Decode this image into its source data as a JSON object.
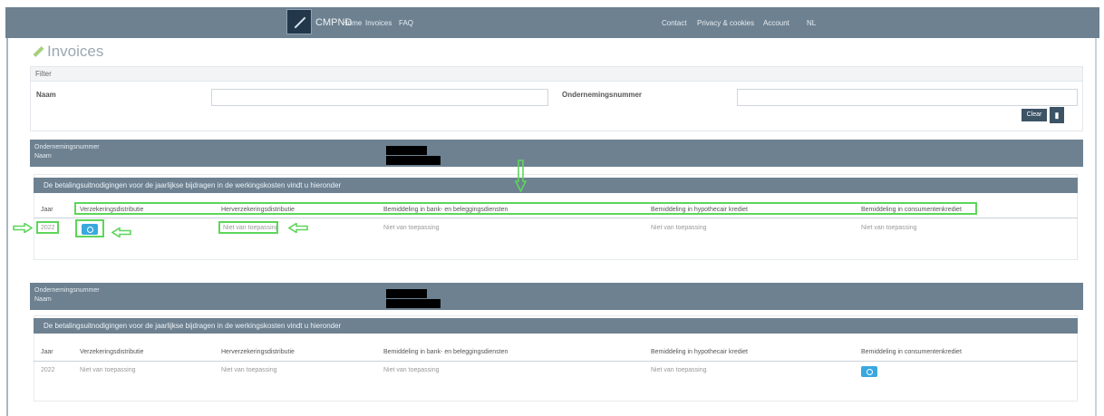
{
  "navbar": {
    "brand_name": "CMPND",
    "left_links": [
      "Home",
      "Invoices",
      "FAQ"
    ],
    "right_links": [
      "Contact",
      "Privacy & cookies",
      "Account",
      "NL"
    ]
  },
  "page": {
    "title": "Invoices"
  },
  "filter": {
    "header": "Filter",
    "name_label": "Naam",
    "enterprise_label": "Ondernemingsnummer",
    "name_value": "",
    "enterprise_value": "",
    "clear_label": "Clear",
    "filter_icon": "filter-icon"
  },
  "blocks": [
    {
      "labels": [
        "Ondernemingsnummer",
        "Naam"
      ],
      "notice": "De betalingsuitnodigingen voor de jaarlijkse bijdragen in de werkingskosten vindt u hieronder",
      "columns": [
        "Jaar",
        "Verzekeringsdistributie",
        "Herverzekeringsdistributie",
        "Bemiddeling in bank- en beleggingsdiensten",
        "Bemiddeling in hypothecair krediet",
        "Bemiddeling in consumentenkrediet"
      ],
      "row": {
        "year": "2022",
        "cells": [
          "",
          "Niet van toepassing",
          "Niet van toepassing",
          "Niet van toepassing",
          "Niet van toepassing"
        ],
        "button_col": 1
      }
    },
    {
      "labels": [
        "Ondernemingsnummer",
        "Naam"
      ],
      "notice": "De betalingsuitnodigingen voor de jaarlijkse bijdragen in de werkingskosten vindt u hieronder",
      "columns": [
        "Jaar",
        "Verzekeringsdistributie",
        "Herverzekeringsdistributie",
        "Bemiddeling in bank- en beleggingsdiensten",
        "Bemiddeling in hypothecair krediet",
        "Bemiddeling in consumentenkrediet"
      ],
      "row": {
        "year": "2022",
        "cells": [
          "Niet van toepassing",
          "Niet van toepassing",
          "Niet van toepassing",
          "Niet van toepassing",
          ""
        ],
        "button_col": 5
      }
    }
  ],
  "colors": {
    "navbar": "#6d8191",
    "button": "#3aa8df",
    "highlight": "#5ed65a"
  }
}
